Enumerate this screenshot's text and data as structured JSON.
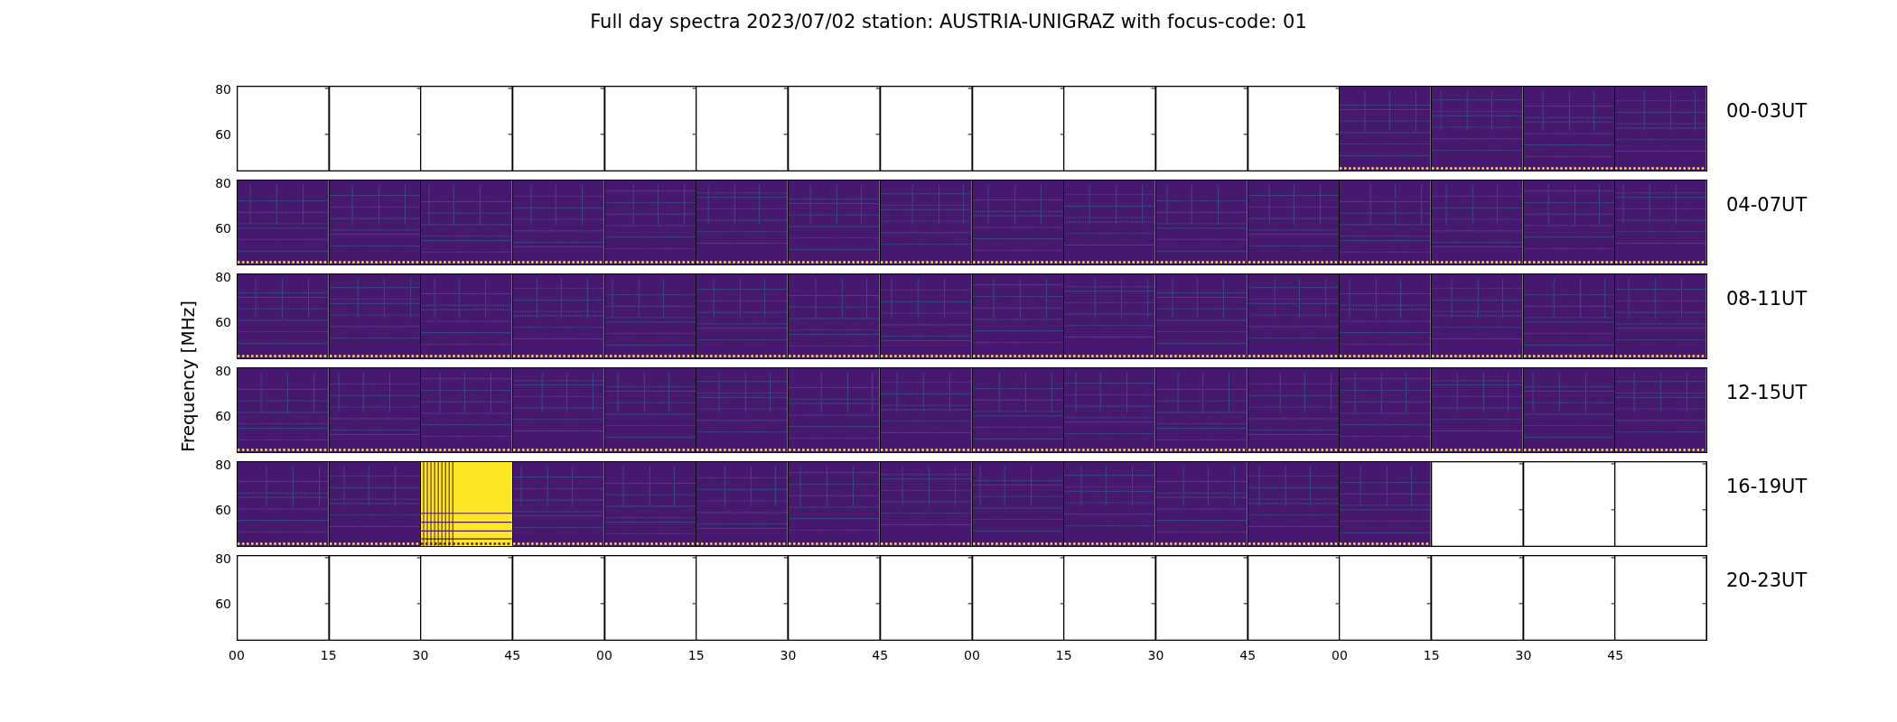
{
  "title": "Full day spectra 2023/07/02 station: AUSTRIA-UNIGRAZ with focus-code: 01",
  "ylabel": "Frequency [MHz]",
  "rows": [
    {
      "label": "00-03UT",
      "yticks": [
        "80",
        "60"
      ],
      "panels": [
        {
          "kind": "empty"
        },
        {
          "kind": "empty"
        },
        {
          "kind": "empty"
        },
        {
          "kind": "empty"
        },
        {
          "kind": "empty"
        },
        {
          "kind": "empty"
        },
        {
          "kind": "empty"
        },
        {
          "kind": "empty"
        },
        {
          "kind": "empty"
        },
        {
          "kind": "empty"
        },
        {
          "kind": "empty"
        },
        {
          "kind": "empty"
        },
        {
          "kind": "spectrum"
        },
        {
          "kind": "spectrum"
        },
        {
          "kind": "spectrum"
        },
        {
          "kind": "spectrum"
        }
      ]
    },
    {
      "label": "04-07UT",
      "yticks": [
        "80",
        "60"
      ],
      "panels": [
        {
          "kind": "spectrum"
        },
        {
          "kind": "spectrum"
        },
        {
          "kind": "spectrum"
        },
        {
          "kind": "spectrum"
        },
        {
          "kind": "spectrum"
        },
        {
          "kind": "spectrum"
        },
        {
          "kind": "spectrum"
        },
        {
          "kind": "spectrum"
        },
        {
          "kind": "spectrum"
        },
        {
          "kind": "spectrum"
        },
        {
          "kind": "spectrum"
        },
        {
          "kind": "spectrum"
        },
        {
          "kind": "spectrum"
        },
        {
          "kind": "spectrum"
        },
        {
          "kind": "spectrum"
        },
        {
          "kind": "spectrum"
        }
      ]
    },
    {
      "label": "08-11UT",
      "yticks": [
        "80",
        "60"
      ],
      "panels": [
        {
          "kind": "spectrum"
        },
        {
          "kind": "spectrum"
        },
        {
          "kind": "spectrum"
        },
        {
          "kind": "spectrum"
        },
        {
          "kind": "spectrum"
        },
        {
          "kind": "spectrum"
        },
        {
          "kind": "spectrum"
        },
        {
          "kind": "spectrum"
        },
        {
          "kind": "spectrum"
        },
        {
          "kind": "spectrum"
        },
        {
          "kind": "spectrum"
        },
        {
          "kind": "spectrum"
        },
        {
          "kind": "spectrum"
        },
        {
          "kind": "spectrum"
        },
        {
          "kind": "spectrum"
        },
        {
          "kind": "spectrum"
        }
      ]
    },
    {
      "label": "12-15UT",
      "yticks": [
        "80",
        "60"
      ],
      "panels": [
        {
          "kind": "spectrum"
        },
        {
          "kind": "spectrum"
        },
        {
          "kind": "spectrum"
        },
        {
          "kind": "spectrum"
        },
        {
          "kind": "spectrum"
        },
        {
          "kind": "spectrum"
        },
        {
          "kind": "spectrum"
        },
        {
          "kind": "spectrum"
        },
        {
          "kind": "spectrum"
        },
        {
          "kind": "spectrum"
        },
        {
          "kind": "spectrum"
        },
        {
          "kind": "spectrum"
        },
        {
          "kind": "spectrum"
        },
        {
          "kind": "spectrum"
        },
        {
          "kind": "spectrum"
        },
        {
          "kind": "spectrum"
        }
      ]
    },
    {
      "label": "16-19UT",
      "yticks": [
        "80",
        "60"
      ],
      "panels": [
        {
          "kind": "spectrum"
        },
        {
          "kind": "spectrum"
        },
        {
          "kind": "saturated"
        },
        {
          "kind": "spectrum"
        },
        {
          "kind": "spectrum"
        },
        {
          "kind": "spectrum"
        },
        {
          "kind": "spectrum"
        },
        {
          "kind": "spectrum"
        },
        {
          "kind": "spectrum"
        },
        {
          "kind": "spectrum"
        },
        {
          "kind": "spectrum"
        },
        {
          "kind": "spectrum"
        },
        {
          "kind": "spectrum"
        },
        {
          "kind": "empty"
        },
        {
          "kind": "empty"
        },
        {
          "kind": "empty"
        }
      ]
    },
    {
      "label": "20-23UT",
      "yticks": [
        "80",
        "60"
      ],
      "panels": [
        {
          "kind": "empty"
        },
        {
          "kind": "empty"
        },
        {
          "kind": "empty"
        },
        {
          "kind": "empty"
        },
        {
          "kind": "empty"
        },
        {
          "kind": "empty"
        },
        {
          "kind": "empty"
        },
        {
          "kind": "empty"
        },
        {
          "kind": "empty"
        },
        {
          "kind": "empty"
        },
        {
          "kind": "empty"
        },
        {
          "kind": "empty"
        },
        {
          "kind": "empty"
        },
        {
          "kind": "empty"
        },
        {
          "kind": "empty"
        },
        {
          "kind": "empty"
        }
      ]
    }
  ],
  "xticks": [
    "00",
    "15",
    "30",
    "45",
    "00",
    "15",
    "30",
    "45",
    "00",
    "15",
    "30",
    "45",
    "00",
    "15",
    "30",
    "45"
  ]
}
